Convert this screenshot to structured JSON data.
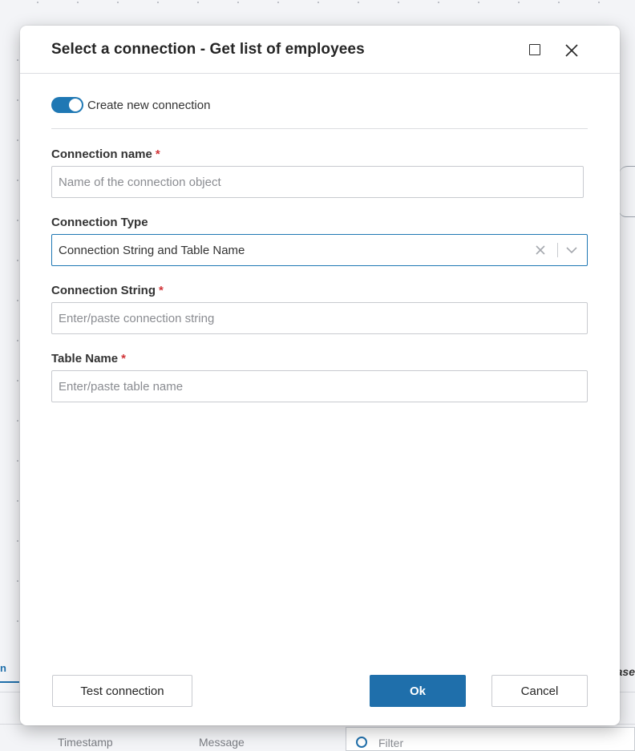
{
  "dialog": {
    "title": "Select a connection - Get list of employees",
    "toggle": {
      "label": "Create new connection",
      "on": true
    },
    "fields": {
      "connection_name": {
        "label": "Connection name",
        "required_mark": "*",
        "placeholder": "Name of the connection object",
        "value": ""
      },
      "connection_type": {
        "label": "Connection Type",
        "value": "Connection String and Table Name"
      },
      "connection_string": {
        "label": "Connection String",
        "required_mark": "*",
        "placeholder": "Enter/paste connection string",
        "value": ""
      },
      "table_name": {
        "label": "Table Name",
        "required_mark": "*",
        "placeholder": "Enter/paste table name",
        "value": ""
      }
    },
    "buttons": {
      "test": "Test connection",
      "ok": "Ok",
      "cancel": "Cancel"
    }
  },
  "background": {
    "tab_left_fragment": "n",
    "tab_right_fragment": "ase",
    "columns": [
      "Timestamp",
      "Message"
    ],
    "filter_placeholder": "Filter"
  },
  "colors": {
    "accent": "#1f6fab",
    "required": "#d13438",
    "toggle_on": "#1f78b4"
  },
  "icons": [
    "maximize-icon",
    "close-icon",
    "clear-icon",
    "chevron-down-icon",
    "search-icon"
  ]
}
